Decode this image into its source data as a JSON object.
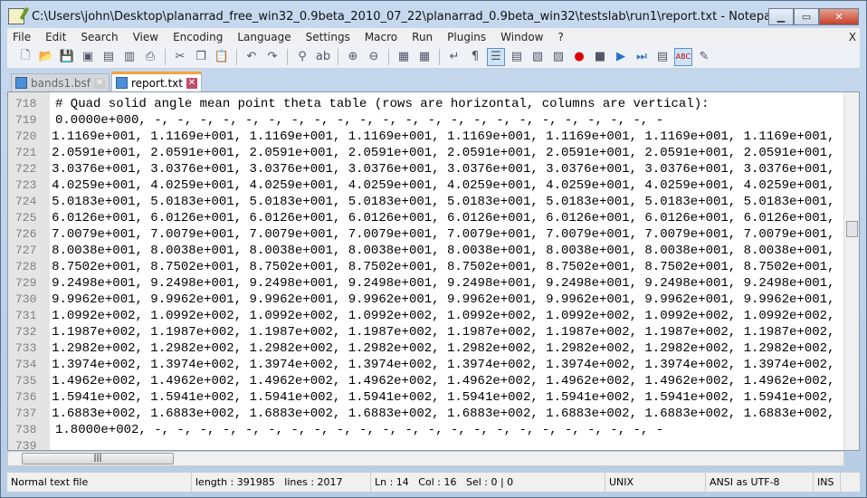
{
  "window": {
    "title": "C:\\Users\\john\\Desktop\\planarrad_free_win32_0.9beta_2010_07_22\\planarrad_0.9beta_win32\\testslab\\run1\\report.txt - Notepad++",
    "minimize": "▁",
    "maximize": "▭",
    "close": "✕"
  },
  "menu": [
    "File",
    "Edit",
    "Search",
    "View",
    "Encoding",
    "Language",
    "Settings",
    "Macro",
    "Run",
    "Plugins",
    "Window",
    "?"
  ],
  "menu_close": "X",
  "toolbar": [
    "new-file",
    "open",
    "save",
    "save-all",
    "close",
    "close-all",
    "print",
    "cut",
    "copy",
    "paste",
    "undo",
    "redo",
    "find",
    "replace",
    "zoom-in",
    "zoom-out",
    "sync-vertical",
    "sync-horizontal",
    "word-wrap",
    "show-all-chars",
    "indent-guide",
    "user-defined-language",
    "folder",
    "map",
    "start-record",
    "stop-record",
    "playback",
    "run-multiple",
    "save-macro",
    "spell-check",
    "abc-check"
  ],
  "tabs": [
    {
      "label": "bands1.bsf",
      "active": false
    },
    {
      "label": "report.txt",
      "active": true
    }
  ],
  "editor": {
    "lines": [
      {
        "n": "718",
        "t": "# Quad solid angle mean point theta table (rows are horizontal, columns are vertical):"
      },
      {
        "n": "719",
        "t": "0.0000e+000, -, -, -, -, -, -, -, -, -, -, -, -, -, -, -, -, -, -, -, -, -, -, -"
      },
      {
        "n": "720",
        "t": "1.1169e+001, 1.1169e+001, 1.1169e+001, 1.1169e+001, 1.1169e+001, 1.1169e+001, 1.1169e+001, 1.1169e+001, 1.1169e+001,"
      },
      {
        "n": "721",
        "t": "2.0591e+001, 2.0591e+001, 2.0591e+001, 2.0591e+001, 2.0591e+001, 2.0591e+001, 2.0591e+001, 2.0591e+001, 2.0591e+001,"
      },
      {
        "n": "722",
        "t": "3.0376e+001, 3.0376e+001, 3.0376e+001, 3.0376e+001, 3.0376e+001, 3.0376e+001, 3.0376e+001, 3.0376e+001, 3.0376e+001,"
      },
      {
        "n": "723",
        "t": "4.0259e+001, 4.0259e+001, 4.0259e+001, 4.0259e+001, 4.0259e+001, 4.0259e+001, 4.0259e+001, 4.0259e+001, 4.0259e+001,"
      },
      {
        "n": "724",
        "t": "5.0183e+001, 5.0183e+001, 5.0183e+001, 5.0183e+001, 5.0183e+001, 5.0183e+001, 5.0183e+001, 5.0183e+001, 5.0183e+001,"
      },
      {
        "n": "725",
        "t": "6.0126e+001, 6.0126e+001, 6.0126e+001, 6.0126e+001, 6.0126e+001, 6.0126e+001, 6.0126e+001, 6.0126e+001, 6.0126e+001,"
      },
      {
        "n": "726",
        "t": "7.0079e+001, 7.0079e+001, 7.0079e+001, 7.0079e+001, 7.0079e+001, 7.0079e+001, 7.0079e+001, 7.0079e+001, 7.0079e+001,"
      },
      {
        "n": "727",
        "t": "8.0038e+001, 8.0038e+001, 8.0038e+001, 8.0038e+001, 8.0038e+001, 8.0038e+001, 8.0038e+001, 8.0038e+001, 8.0038e+001,"
      },
      {
        "n": "728",
        "t": "8.7502e+001, 8.7502e+001, 8.7502e+001, 8.7502e+001, 8.7502e+001, 8.7502e+001, 8.7502e+001, 8.7502e+001, 8.7502e+001,"
      },
      {
        "n": "729",
        "t": "9.2498e+001, 9.2498e+001, 9.2498e+001, 9.2498e+001, 9.2498e+001, 9.2498e+001, 9.2498e+001, 9.2498e+001, 9.2498e+001,"
      },
      {
        "n": "730",
        "t": "9.9962e+001, 9.9962e+001, 9.9962e+001, 9.9962e+001, 9.9962e+001, 9.9962e+001, 9.9962e+001, 9.9962e+001, 9.9962e+001,"
      },
      {
        "n": "731",
        "t": "1.0992e+002, 1.0992e+002, 1.0992e+002, 1.0992e+002, 1.0992e+002, 1.0992e+002, 1.0992e+002, 1.0992e+002, 1.0992e+002,"
      },
      {
        "n": "732",
        "t": "1.1987e+002, 1.1987e+002, 1.1987e+002, 1.1987e+002, 1.1987e+002, 1.1987e+002, 1.1987e+002, 1.1987e+002, 1.1987e+002,"
      },
      {
        "n": "733",
        "t": "1.2982e+002, 1.2982e+002, 1.2982e+002, 1.2982e+002, 1.2982e+002, 1.2982e+002, 1.2982e+002, 1.2982e+002, 1.2982e+002,"
      },
      {
        "n": "734",
        "t": "1.3974e+002, 1.3974e+002, 1.3974e+002, 1.3974e+002, 1.3974e+002, 1.3974e+002, 1.3974e+002, 1.3974e+002, 1.3974e+002,"
      },
      {
        "n": "735",
        "t": "1.4962e+002, 1.4962e+002, 1.4962e+002, 1.4962e+002, 1.4962e+002, 1.4962e+002, 1.4962e+002, 1.4962e+002, 1.4962e+002,"
      },
      {
        "n": "736",
        "t": "1.5941e+002, 1.5941e+002, 1.5941e+002, 1.5941e+002, 1.5941e+002, 1.5941e+002, 1.5941e+002, 1.5941e+002, 1.5941e+002,"
      },
      {
        "n": "737",
        "t": "1.6883e+002, 1.6883e+002, 1.6883e+002, 1.6883e+002, 1.6883e+002, 1.6883e+002, 1.6883e+002, 1.6883e+002, 1.6883e+002,"
      },
      {
        "n": "738",
        "t": "1.8000e+002, -, -, -, -, -, -, -, -, -, -, -, -, -, -, -, -, -, -, -, -, -, -, -"
      },
      {
        "n": "739",
        "t": ""
      }
    ]
  },
  "status": {
    "type": "Normal text file",
    "length": "length : 391985",
    "lines": "lines : 2017",
    "ln": "Ln : 14",
    "col": "Col : 16",
    "sel": "Sel : 0 | 0",
    "eol": "UNIX",
    "encoding": "ANSI as UTF-8",
    "mode": "INS"
  },
  "colors": {
    "tab_accent": "#f8a33a",
    "gutter": "#e4e4e4",
    "line_number": "#808080"
  }
}
